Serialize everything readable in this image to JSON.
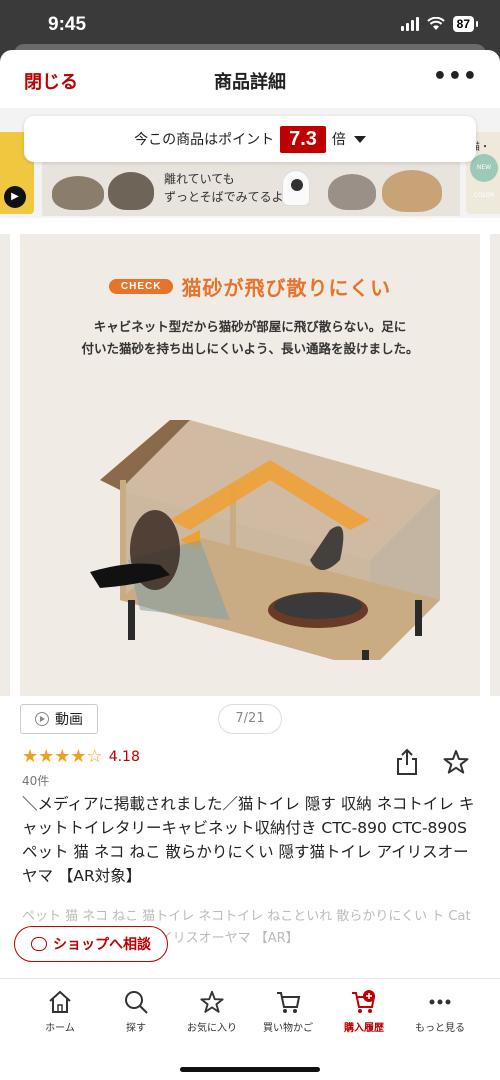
{
  "status": {
    "time": "9:45",
    "battery": "87"
  },
  "nav": {
    "close": "閉じる",
    "title": "商品詳細",
    "more": "•••"
  },
  "points": {
    "prefix": "今この商品はポイント",
    "multiplier": "7.3",
    "suffix": "倍"
  },
  "banner": {
    "line1": "離れていても",
    "line2": "ずっとそばでみてるよ"
  },
  "thumb_right": {
    "label": "猫・",
    "badge": "NEW COLOR"
  },
  "main_image": {
    "badge": "CHECK",
    "headline": "猫砂が飛び散りにくい",
    "desc_line1": "キャビネット型だから猫砂が部屋に飛び散らない。足に",
    "desc_line2": "付いた猫砂を持ち出しにくいよう、長い通路を設けました。"
  },
  "media": {
    "video_label": "動画",
    "counter": "7/21"
  },
  "rating": {
    "value": "4.18",
    "stars": 4.18,
    "reviews": "40件"
  },
  "product": {
    "title": "＼メディアに掲載されました／猫トイレ 隠す 収納 ネコトイレ キャットトイレタリーキャビネット収納付き CTC-890 CTC-890S ペット 猫 ネコ ねこ 散らかりにくい 隠す猫トイレ アイリスオーヤマ 【AR対象】",
    "subtitle": "ペット 猫 ネコ ねこ 猫トイレ ネコトイレ ねこといれ 散らかりにくい ト Cat ＣＡＴ 隠す猫トイレ アイリスオーヤマ 【AR】"
  },
  "consult": {
    "label": "ショップへ相談"
  },
  "tabs": [
    {
      "label": "ホーム",
      "icon": "home-icon"
    },
    {
      "label": "探す",
      "icon": "search-icon"
    },
    {
      "label": "お気に入り",
      "icon": "star-icon"
    },
    {
      "label": "買い物かご",
      "icon": "cart-icon"
    },
    {
      "label": "購入履歴",
      "icon": "purchase-history-icon"
    },
    {
      "label": "もっと見る",
      "icon": "more-icon"
    }
  ],
  "colors": {
    "brand": "#bf0000",
    "accent": "#e6742b",
    "star": "#f0a020"
  }
}
